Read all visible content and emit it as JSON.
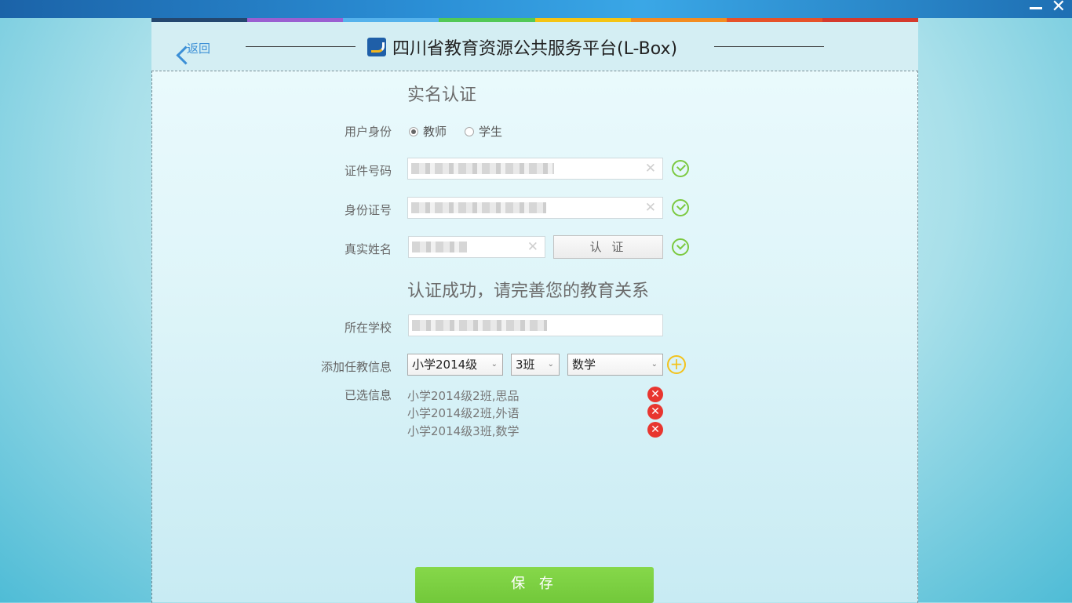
{
  "header": {
    "back_label": "返回",
    "title": "四川省教育资源公共服务平台(L-Box)"
  },
  "colors": {
    "accent": "#3b8fd6",
    "success": "#7cc940",
    "danger": "#e8362f",
    "add": "#f3c21b",
    "save": "#7ccf42",
    "stripe": [
      "#24476f",
      "#9a5fd1",
      "#55b2ec",
      "#52c957",
      "#f4c414",
      "#f28c21",
      "#e5522a",
      "#d43a2d"
    ]
  },
  "auth": {
    "section_title": "实名认证",
    "identity_label": "用户身份",
    "identity_options": [
      {
        "label": "教师",
        "checked": true
      },
      {
        "label": "学生",
        "checked": false
      }
    ],
    "cert_label": "证件号码",
    "idcard_label": "身份证号",
    "name_label": "真实姓名",
    "verify_label": "认 证",
    "clear_glyph": "✕"
  },
  "relation": {
    "section_title": "认证成功，请完善您的教育关系",
    "school_label": "所在学校",
    "add_label": "添加任教信息",
    "grade_value": "小学2014级",
    "class_value": "3班",
    "subject_value": "数学",
    "selected_label": "已选信息",
    "selected_items": [
      "小学2014级2班,思品",
      "小学2014级2班,外语",
      "小学2014级3班,数学"
    ],
    "delete_glyph": "✕",
    "add_glyph": "+"
  },
  "save_label": "保 存",
  "window": {
    "close_glyph": "✕"
  }
}
